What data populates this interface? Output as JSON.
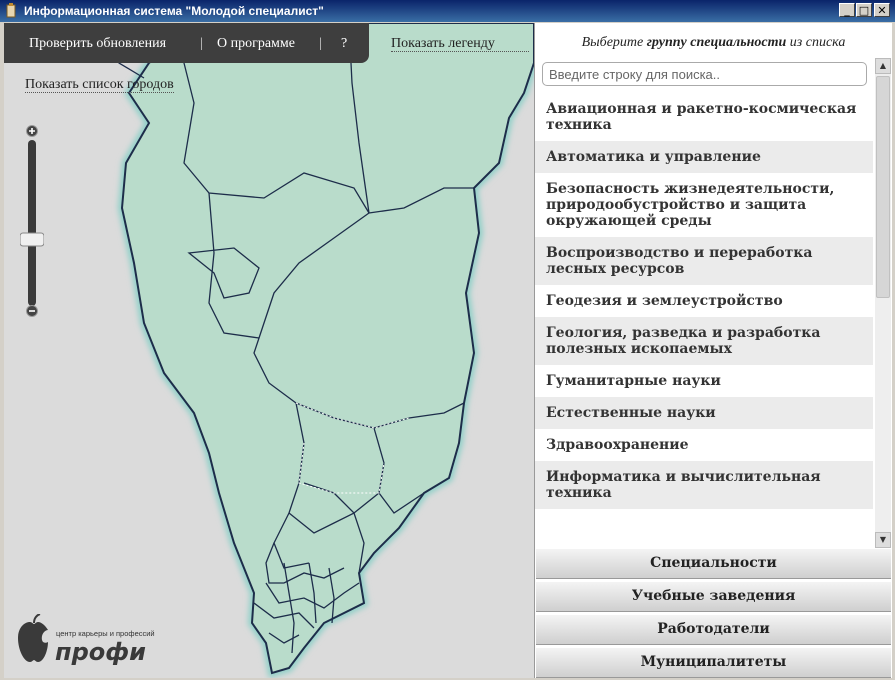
{
  "window": {
    "title": "Информационная система \"Молодой специалист\""
  },
  "toolbar": {
    "check_updates": "Проверить обновления",
    "about": "О программе",
    "help": "?",
    "separator": "|"
  },
  "map": {
    "show_legend": "Показать легенду",
    "show_cities": "Показать список городов",
    "logo_tagline": "центр карьеры и профессий",
    "logo_word": "профи"
  },
  "panel": {
    "prompt_pre": "Выберите",
    "prompt_bold": "группу специальности",
    "prompt_post": "из списка",
    "search_placeholder": "Введите строку для поиска..",
    "items": [
      "Авиационная и ракетно-космическая техника",
      "Автоматика и управление",
      "Безопасность жизнедеятельности, природообустройство и защита окружающей среды",
      "Воспроизводство и переработка лесных ресурсов",
      "Геодезия и землеустройство",
      "Геология, разведка и разработка полезных ископаемых",
      "Гуманитарные науки",
      "Естественные науки",
      "Здравоохранение",
      "Информатика и вычислительная техника"
    ],
    "sections": [
      "Специальности",
      "Учебные заведения",
      "Работодатели",
      "Муниципалитеты"
    ]
  },
  "colors": {
    "map_fill": "#b9dccb",
    "map_bg": "#dbdbdb",
    "toolbar_bg": "#3e3e3e",
    "title_bar": "#0a246a"
  },
  "icons": [
    "app-icon",
    "minimize-icon",
    "maximize-icon",
    "close-icon",
    "zoom-in-icon",
    "zoom-out-icon",
    "scroll-up-icon",
    "scroll-down-icon",
    "profi-logo-icon"
  ]
}
